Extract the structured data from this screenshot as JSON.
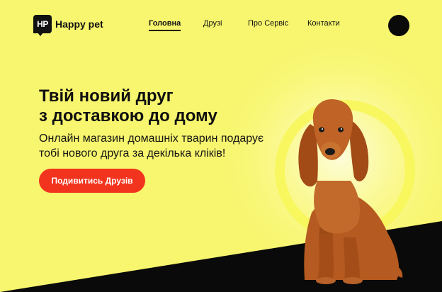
{
  "brand": {
    "logo_mark": "HP",
    "name": "Happy pet"
  },
  "nav": {
    "items": [
      {
        "label": "Головна",
        "active": true
      },
      {
        "label": "Друзі",
        "active": false
      },
      {
        "label": "Про Сервіс",
        "active": false
      },
      {
        "label": "Контакти",
        "active": false
      }
    ]
  },
  "hero": {
    "title_line1": "Твій новий друг",
    "title_line2": "з доставкою до дому",
    "subtitle_line1": "Онлайн магазин домашніх тварин подарує",
    "subtitle_line2": "тобі нового друга за декілька кліків!",
    "cta_label": "Подивитись Друзів"
  },
  "colors": {
    "background": "#f8f66e",
    "accent": "#f2331d",
    "dark": "#0a0a0a"
  }
}
